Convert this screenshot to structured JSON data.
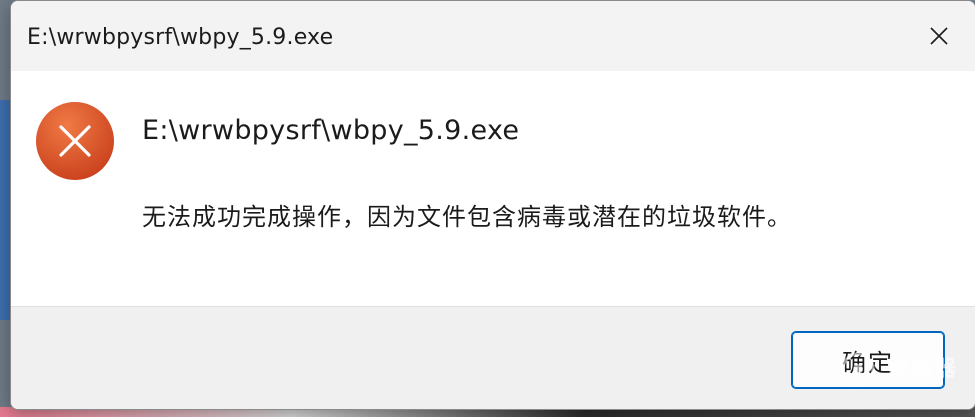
{
  "window": {
    "title": "E:\\wrwbpysrf\\wbpy_5.9.exe"
  },
  "dialog": {
    "heading": "E:\\wrwbpysrf\\wbpy_5.9.exe",
    "message": "无法成功完成操作，因为文件包含病毒或潜在的垃圾软件。",
    "icon": "error-icon",
    "ok_label": "确定"
  },
  "watermark": {
    "text": "路由器",
    "sub": "luyouqi.com"
  },
  "colors": {
    "error_red": "#e0502a",
    "accent_blue": "#0067c0",
    "titlebar_bg": "#f3f3f3",
    "footer_bg": "#f0f0f0"
  }
}
